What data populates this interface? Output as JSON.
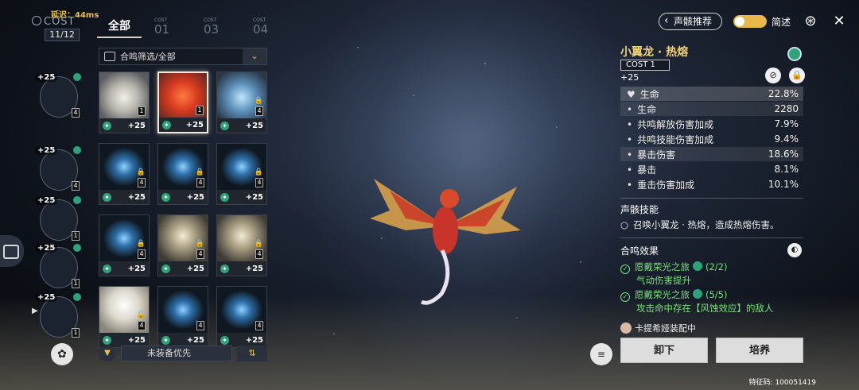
{
  "status": {
    "latency": "延迟：44ms",
    "cost_label": "COST",
    "cost_count": "11/12"
  },
  "tabs": [
    {
      "label": "全部",
      "small": "",
      "num": ""
    },
    {
      "label": "",
      "small": "COST",
      "num": "01"
    },
    {
      "label": "",
      "small": "COST",
      "num": "03"
    },
    {
      "label": "",
      "small": "COST",
      "num": "04"
    }
  ],
  "filter": {
    "label": "合鸣筛选/全部",
    "chevron": "⌄"
  },
  "cards": [
    {
      "art": "art-white",
      "plus": "+25",
      "cost": "1",
      "lock": ""
    },
    {
      "art": "art-red",
      "plus": "+25",
      "cost": "1",
      "lock": ""
    },
    {
      "art": "art-ice",
      "plus": "+25",
      "cost": "4",
      "lock": "🔒"
    },
    {
      "art": "art-spirit",
      "plus": "+25",
      "cost": "4",
      "lock": "🔒"
    },
    {
      "art": "art-spirit",
      "plus": "+25",
      "cost": "4",
      "lock": "🔒"
    },
    {
      "art": "art-spirit",
      "plus": "+25",
      "cost": "4",
      "lock": "🔒"
    },
    {
      "art": "art-spirit",
      "plus": "+25",
      "cost": "4",
      "lock": "🔒"
    },
    {
      "art": "art-bird",
      "plus": "+25",
      "cost": "4",
      "lock": "🔒"
    },
    {
      "art": "art-bird",
      "plus": "+25",
      "cost": "4",
      "lock": "🔒"
    },
    {
      "art": "art-feather",
      "plus": "+25",
      "cost": "4",
      "lock": "🔒"
    },
    {
      "art": "art-spirit",
      "plus": "+25",
      "cost": "4",
      "lock": ""
    },
    {
      "art": "art-spirit",
      "plus": "+25",
      "cost": "4",
      "lock": ""
    }
  ],
  "sortbar": {
    "icon": "▼",
    "label": "未装备优先",
    "dir": "⇅"
  },
  "slots": [
    {
      "plus": "+25",
      "cost": "4"
    },
    {
      "plus": "+25",
      "cost": "4"
    },
    {
      "plus": "+25",
      "cost": "1"
    },
    {
      "plus": "+25",
      "cost": "1"
    },
    {
      "plus": "+25",
      "cost": "1"
    }
  ],
  "header": {
    "echo_recommend": "声骸推荐",
    "description": "简述",
    "icon_compass": "⊛",
    "icon_close": "✕"
  },
  "echo": {
    "name": "小翼龙 · 热熔",
    "cost": "COST 1",
    "level": "+25",
    "stats": [
      {
        "label": "生命",
        "value": "22.8%"
      },
      {
        "label": "生命",
        "value": "2280"
      },
      {
        "label": "共鸣解放伤害加成",
        "value": "7.9%"
      },
      {
        "label": "共鸣技能伤害加成",
        "value": "9.4%"
      },
      {
        "label": "暴击伤害",
        "value": "18.6%"
      },
      {
        "label": "暴击",
        "value": "8.1%"
      },
      {
        "label": "重击伤害加成",
        "value": "10.1%"
      }
    ],
    "skill_title": "声骸技能",
    "skill_text": "召唤小翼龙 · 热熔，造成热熔伤害。",
    "sonata_title": "合鸣效果",
    "sets": [
      {
        "name": "愿戴荣光之旅",
        "count": "(2/2)",
        "desc": "气动伤害提升"
      },
      {
        "name": "愿戴荣光之旅",
        "count": "(5/5)",
        "desc": "攻击命中存在【风蚀效应】的敌人"
      }
    ],
    "equipped": "卡提希娅装配中"
  },
  "actions": {
    "unequip": "卸下",
    "upgrade": "培养",
    "list_icon": "≡"
  },
  "uid": "特征码: 100051419"
}
